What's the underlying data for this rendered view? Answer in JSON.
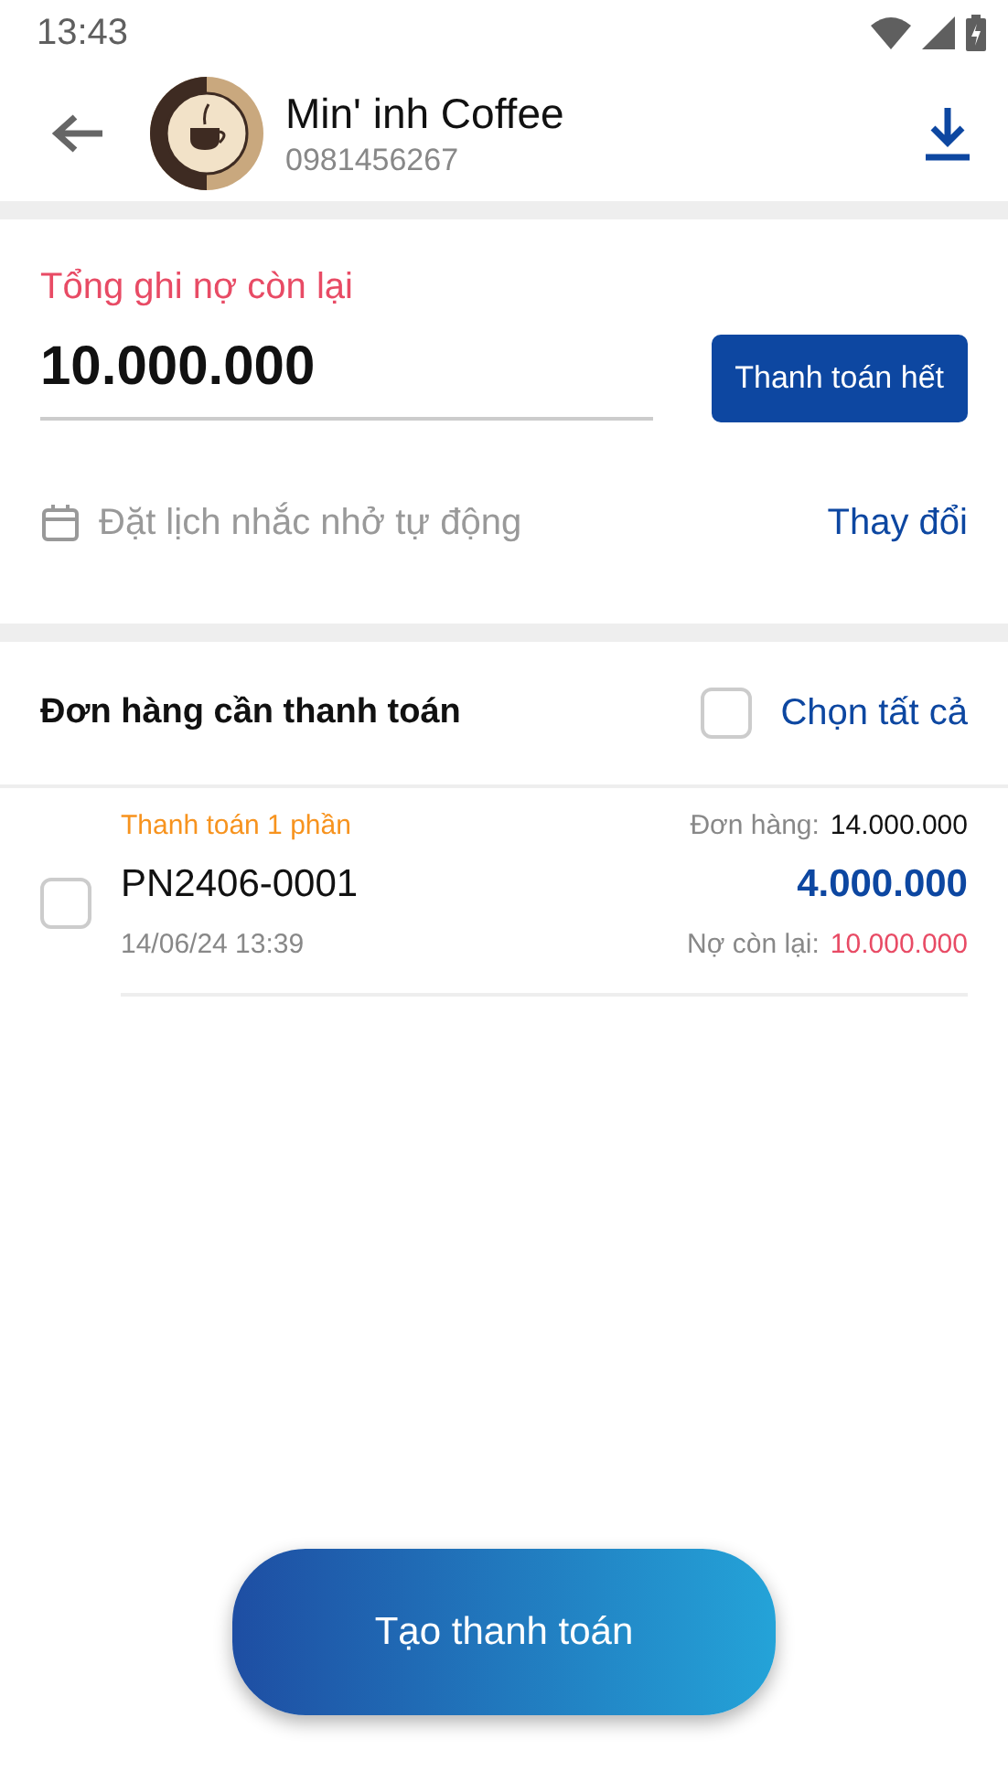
{
  "status_bar": {
    "time": "13:43"
  },
  "header": {
    "name": "Min' inh Coffee",
    "phone": "0981456267"
  },
  "debt": {
    "label": "Tổng ghi nợ còn lại",
    "amount": "10.000.000",
    "pay_all_button": "Thanh toán hết"
  },
  "reminder": {
    "label": "Đặt lịch nhắc nhở tự động",
    "action": "Thay đổi"
  },
  "orders": {
    "title": "Đơn hàng cần thanh toán",
    "select_all": {
      "label": "Chọn tất cả",
      "checked": false
    },
    "items": [
      {
        "status": "Thanh toán 1 phần",
        "order_label": "Đơn hàng:",
        "order_total": "14.000.000",
        "code": "PN2406-0001",
        "amount": "4.000.000",
        "date": "14/06/24 13:39",
        "remaining_label": "Nợ còn lại:",
        "remaining": "10.000.000",
        "checked": false
      }
    ]
  },
  "create_button": "Tạo thanh toán"
}
